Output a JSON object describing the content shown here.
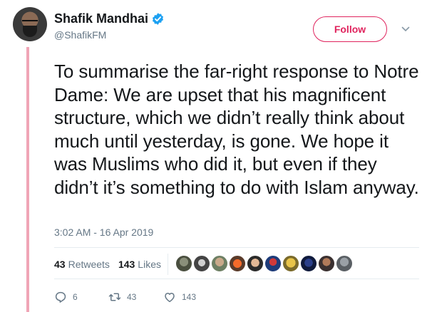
{
  "tweet": {
    "author": {
      "display_name": "Shafik Mandhai",
      "handle": "@ShafikFM",
      "verified": true
    },
    "follow_label": "Follow",
    "text": "To summarise the far-right response to Notre Dame: We are upset that his magnificent structure, which we didn’t really think about much until yesterday, is gone. We hope it was Muslims who did it, but even if they didn’t it’s something to do with Islam anyway.",
    "timestamp": "3:02 AM - 16 Apr 2019",
    "stats": {
      "retweets_count": "43",
      "retweets_label": "Retweets",
      "likes_count": "143",
      "likes_label": "Likes"
    },
    "actions": {
      "replies": "6",
      "retweets": "43",
      "likes": "143"
    }
  },
  "colors": {
    "accent": "#e0245e",
    "verified": "#1da1f2",
    "thread_line": "#f0a5b6",
    "muted": "#657786"
  }
}
